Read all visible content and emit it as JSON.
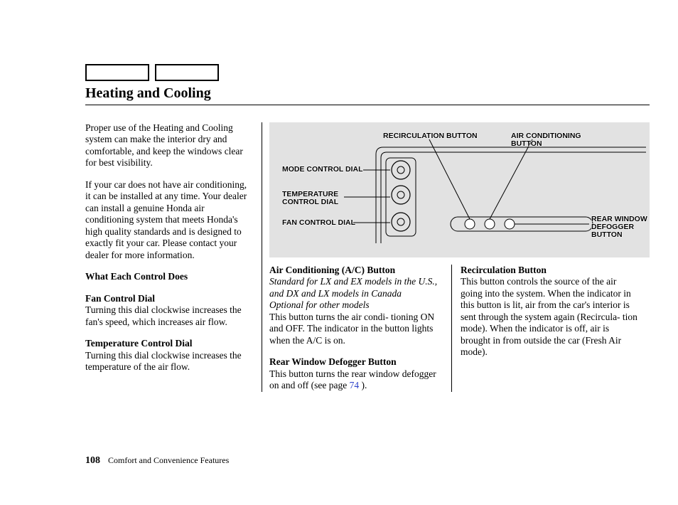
{
  "title": "Heating and Cooling",
  "para": {
    "intro1": "Proper use of the Heating and Cooling system can make the interior dry and comfortable, and keep the windows clear for best visibility.",
    "intro2": "If your car does not have air conditioning, it can be installed at any time. Your dealer can install a genuine Honda air conditioning system that meets Honda's high quality standards and is designed to exactly fit your car. Please contact your dealer for more information.",
    "what_heading": "What Each Control Does",
    "fan_heading": "Fan Control Dial",
    "fan_body": "Turning this dial clockwise increases the fan's speed, which increases air flow.",
    "temp_heading": "Temperature Control Dial",
    "temp_body": "Turning this dial clockwise increases the temperature of the air flow.",
    "ac_heading": "Air Conditioning (A/C) Button",
    "ac_note1": "Standard for LX and EX models in the U.S., and DX and LX models in Canada",
    "ac_note2": "Optional for other models",
    "ac_body": "This button turns the air condi- tioning ON and OFF. The indicator in the button lights when the A/C is on.",
    "rwd_heading": "Rear Window Defogger Button",
    "rwd_body_pre": "This button turns the rear window defogger on and off (see page ",
    "rwd_page": "74",
    "rwd_body_post": " ).",
    "recirc_heading": "Recirculation Button",
    "recirc_body": "This button controls the source of the air going into the system. When the indicator in this button is lit, air from the car's interior is sent through the system again (Recircula- tion mode). When the indicator is off, air is brought in from outside the car (Fresh Air mode)."
  },
  "diagram": {
    "recirc": "RECIRCULATION BUTTON",
    "ac": "AIR CONDITIONING\nBUTTON",
    "mode": "MODE CONTROL DIAL",
    "temp": "TEMPERATURE\nCONTROL DIAL",
    "fan": "FAN CONTROL DIAL",
    "rear": "REAR WINDOW\nDEFOGGER\nBUTTON"
  },
  "footer": {
    "page_number": "108",
    "section": "Comfort and Convenience Features"
  }
}
